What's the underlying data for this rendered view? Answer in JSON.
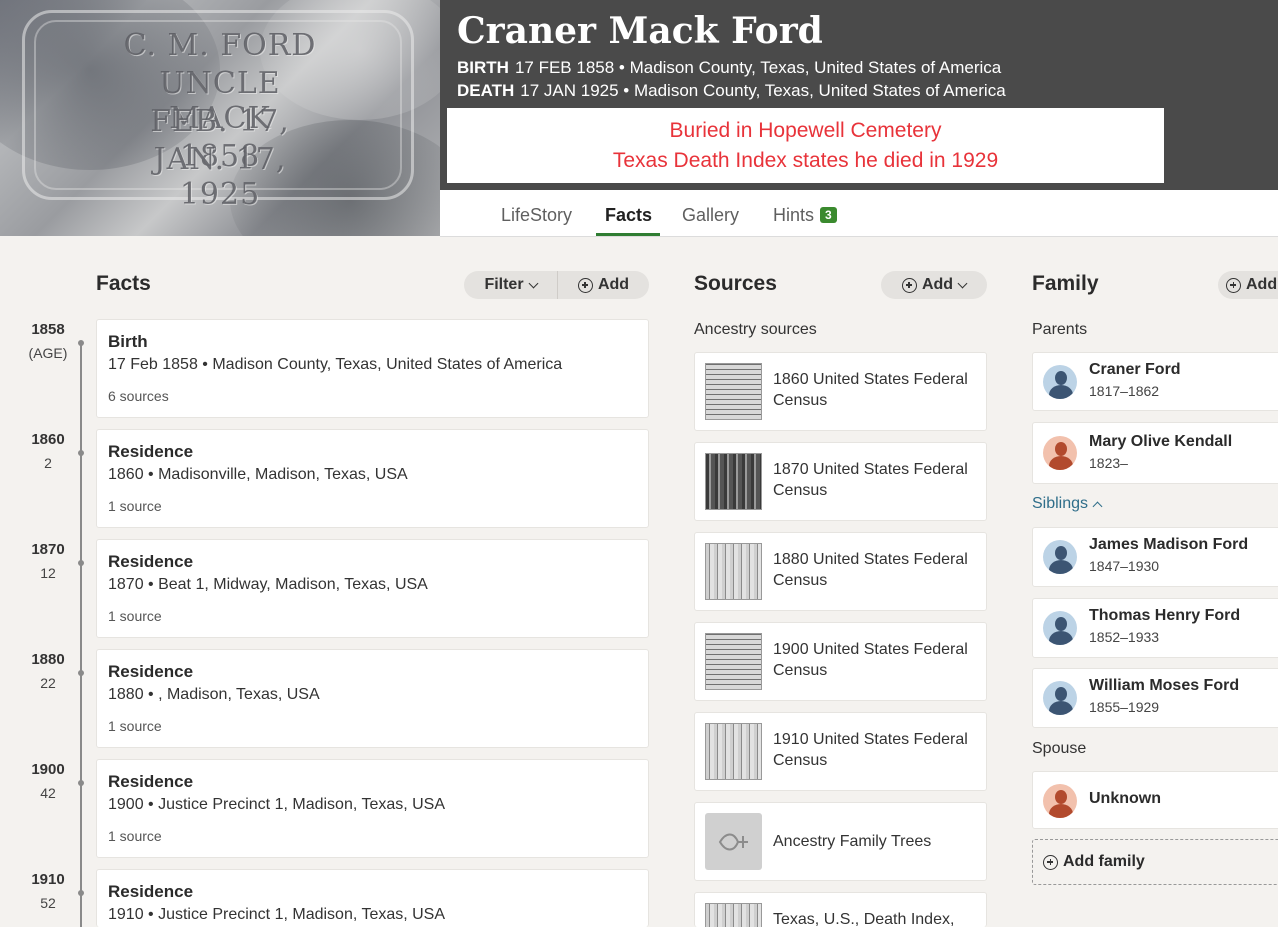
{
  "header": {
    "name": "Craner Mack Ford",
    "birth_label": "BIRTH",
    "birth_value": "17 FEB 1858 • Madison County, Texas, United States of America",
    "death_label": "DEATH",
    "death_value": "17 JAN 1925 • Madison County, Texas, United States of America",
    "note_line1": "Buried in Hopewell Cemetery",
    "note_line2": "Texas Death Index states he died in 1929",
    "headstone": [
      "C. M. FORD",
      "UNCLE MACK",
      "FEB. 17, 1858",
      "JAN. 17, 1925"
    ]
  },
  "tabs": {
    "lifestory": "LifeStory",
    "facts": "Facts",
    "gallery": "Gallery",
    "hints": "Hints",
    "hints_count": "3"
  },
  "facts": {
    "title": "Facts",
    "filter_label": "Filter",
    "add_label": "Add",
    "items": [
      {
        "year": "1858",
        "age": "(AGE)",
        "title": "Birth",
        "detail": "17 Feb 1858 • Madison County, Texas, United States of America",
        "sources": "6 sources"
      },
      {
        "year": "1860",
        "age": "2",
        "title": "Residence",
        "detail": "1860 • Madisonville, Madison, Texas, USA",
        "sources": "1 source"
      },
      {
        "year": "1870",
        "age": "12",
        "title": "Residence",
        "detail": "1870 • Beat 1, Midway, Madison, Texas, USA",
        "sources": "1 source"
      },
      {
        "year": "1880",
        "age": "22",
        "title": "Residence",
        "detail": "1880 • , Madison, Texas, USA",
        "sources": "1 source"
      },
      {
        "year": "1900",
        "age": "42",
        "title": "Residence",
        "detail": "1900 • Justice Precinct 1, Madison, Texas, USA",
        "sources": "1 source"
      },
      {
        "year": "1910",
        "age": "52",
        "title": "Residence",
        "detail": "1910 • Justice Precinct 1, Madison, Texas, USA",
        "sources": ""
      }
    ]
  },
  "sources": {
    "title": "Sources",
    "add_label": "Add",
    "subtitle": "Ancestry sources",
    "items": [
      {
        "title": "1860 United States Federal Census"
      },
      {
        "title": "1870 United States Federal Census"
      },
      {
        "title": "1880 United States Federal Census"
      },
      {
        "title": "1900 United States Federal Census"
      },
      {
        "title": "1910 United States Federal Census"
      },
      {
        "title": "Ancestry Family Trees"
      },
      {
        "title": "Texas, U.S., Death Index,"
      }
    ]
  },
  "family": {
    "title": "Family",
    "add_label": "Add",
    "parents_label": "Parents",
    "siblings_label": "Siblings",
    "spouse_label": "Spouse",
    "add_family_label": "Add family",
    "parents": [
      {
        "name": "Craner Ford",
        "years": "1817–1862"
      },
      {
        "name": "Mary Olive Kendall",
        "years": "1823–"
      }
    ],
    "siblings": [
      {
        "name": "James Madison Ford",
        "years": "1847–1930"
      },
      {
        "name": "Thomas Henry Ford",
        "years": "1852–1933"
      },
      {
        "name": "William Moses Ford",
        "years": "1855–1929"
      }
    ],
    "spouse": [
      {
        "name": "Unknown",
        "years": ""
      }
    ]
  },
  "colors": {
    "header_bg": "#4a4a4a",
    "note_text": "#e8333a",
    "tab_accent": "#2f7d32",
    "badge": "#3a8a2e",
    "link": "#2f6e8a"
  }
}
